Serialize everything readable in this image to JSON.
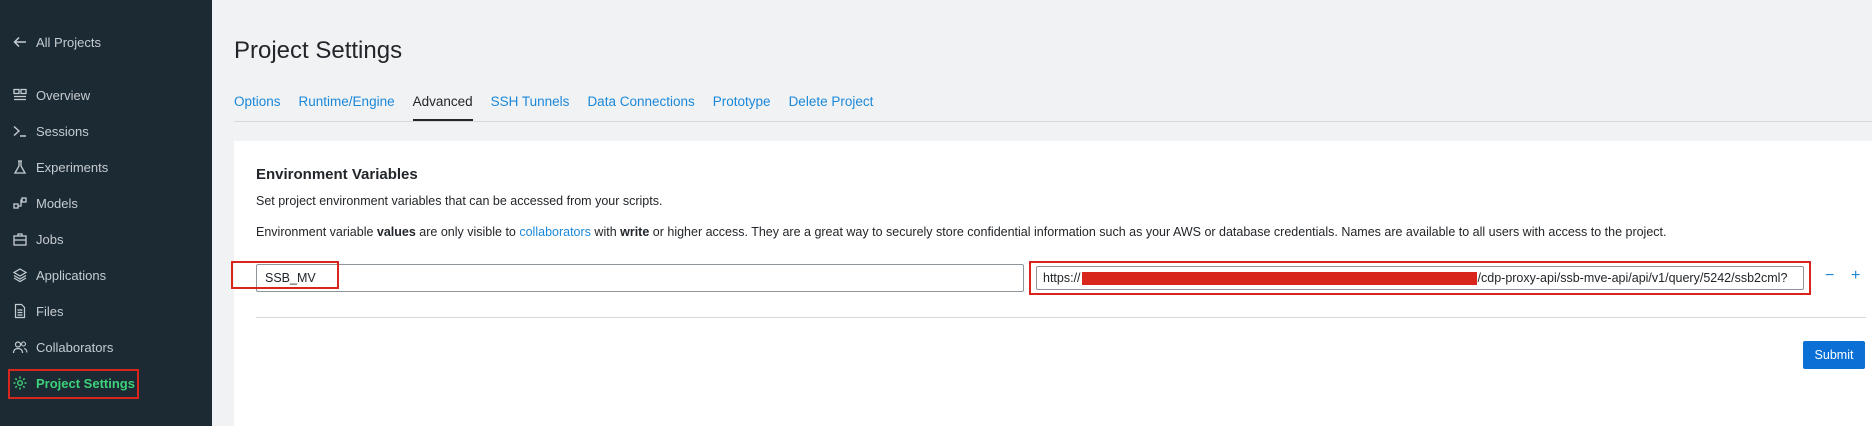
{
  "sidebar": {
    "back_label": "All Projects",
    "items": [
      {
        "label": "Overview",
        "icon": "overview-icon"
      },
      {
        "label": "Sessions",
        "icon": "terminal-icon"
      },
      {
        "label": "Experiments",
        "icon": "flask-icon"
      },
      {
        "label": "Models",
        "icon": "models-icon"
      },
      {
        "label": "Jobs",
        "icon": "briefcase-icon"
      },
      {
        "label": "Applications",
        "icon": "layers-icon"
      },
      {
        "label": "Files",
        "icon": "file-icon"
      },
      {
        "label": "Collaborators",
        "icon": "people-icon"
      },
      {
        "label": "Project Settings",
        "icon": "gear-icon",
        "active": true
      }
    ]
  },
  "page": {
    "title": "Project Settings",
    "tabs": [
      "Options",
      "Runtime/Engine",
      "Advanced",
      "SSH Tunnels",
      "Data Connections",
      "Prototype",
      "Delete Project"
    ],
    "active_tab": "Advanced"
  },
  "env": {
    "section_title": "Environment Variables",
    "description": "Set project environment variables that can be accessed from your scripts.",
    "note": {
      "p1": "Environment variable ",
      "b1": "values",
      "p2": " are only visible to ",
      "link": "collaborators",
      "p3": " with ",
      "b2": "write",
      "p4": " or higher access. They are a great way to securely store confidential information such as your AWS or database credentials. Names are available to all users with access to the project."
    },
    "name_value": "SSB_MV",
    "value_prefix": "https://",
    "value_suffix": "/cdp-proxy-api/ssb-mve-api/api/v1/query/5242/ssb2cml?",
    "remove_label": "−",
    "add_label": "+",
    "submit_label": "Submit"
  },
  "colors": {
    "sidebar_bg": "#1c2b33",
    "active_nav": "#3ed07a",
    "link": "#1a88d9",
    "primary_button": "#0a70d6",
    "highlight_box": "#d9261c"
  }
}
